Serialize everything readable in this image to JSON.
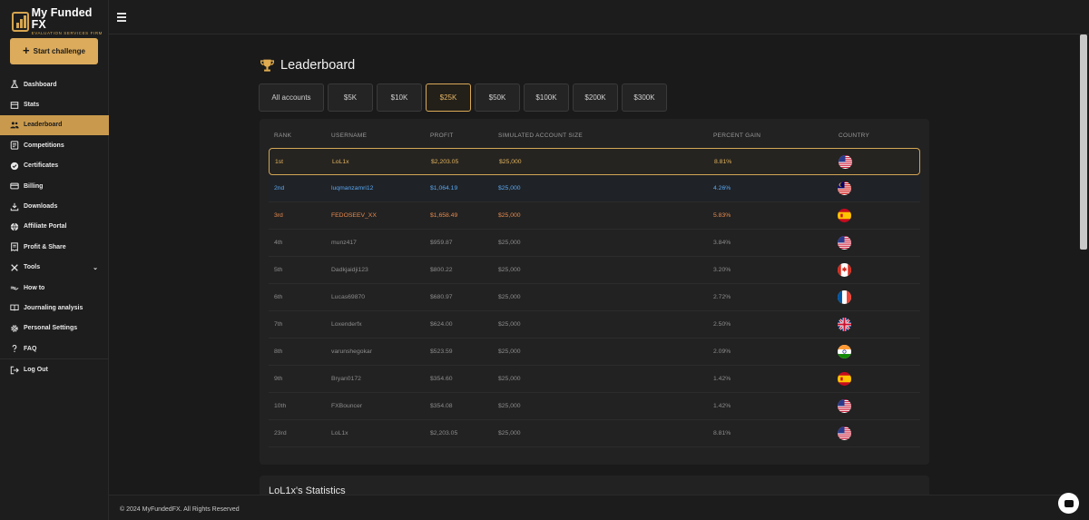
{
  "brand": {
    "name": "My Funded FX",
    "tagline": "EVALUATION SERVICES FIRM",
    "accent": "#dcab5b"
  },
  "sidebar": {
    "start_label": "Start challenge",
    "items": [
      {
        "label": "Dashboard",
        "icon": "flask-icon"
      },
      {
        "label": "Stats",
        "icon": "box-icon"
      },
      {
        "label": "Leaderboard",
        "icon": "users-icon",
        "active": true
      },
      {
        "label": "Competitions",
        "icon": "document-icon"
      },
      {
        "label": "Certificates",
        "icon": "badge-icon"
      },
      {
        "label": "Billing",
        "icon": "card-icon"
      },
      {
        "label": "Downloads",
        "icon": "download-icon"
      },
      {
        "label": "Affiliate Portal",
        "icon": "globe-icon"
      },
      {
        "label": "Profit & Share",
        "icon": "receipt-icon"
      },
      {
        "label": "Tools",
        "icon": "tools-icon"
      },
      {
        "label": "How to",
        "icon": "hand-icon"
      },
      {
        "label": "Journaling analysis",
        "icon": "book-icon"
      },
      {
        "label": "Personal Settings",
        "icon": "gear-icon"
      },
      {
        "label": "FAQ",
        "icon": "question-icon"
      },
      {
        "label": "Log Out",
        "icon": "logout-icon"
      }
    ]
  },
  "leaderboard": {
    "title": "Leaderboard",
    "filters": [
      "All accounts",
      "$5K",
      "$10K",
      "$25K",
      "$50K",
      "$100K",
      "$200K",
      "$300K"
    ],
    "active_filter": "$25K",
    "columns": [
      "RANK",
      "USERNAME",
      "PROFIT",
      "SIMULATED ACCOUNT SIZE",
      "PERCENT GAIN",
      "COUNTRY"
    ],
    "rows": [
      {
        "rank": "1st",
        "username": "LoL1x",
        "profit": "$2,203.05",
        "size": "$25,000",
        "gain": "8.81%",
        "country": "us"
      },
      {
        "rank": "2nd",
        "username": "luqmanzamri12",
        "profit": "$1,064.19",
        "size": "$25,000",
        "gain": "4.26%",
        "country": "my"
      },
      {
        "rank": "3rd",
        "username": "FEDOSEEV_XX",
        "profit": "$1,658.49",
        "size": "$25,000",
        "gain": "5.83%",
        "country": "es"
      },
      {
        "rank": "4th",
        "username": "munz417",
        "profit": "$959.87",
        "size": "$25,000",
        "gain": "3.84%",
        "country": "us"
      },
      {
        "rank": "5th",
        "username": "Dadkjaidji123",
        "profit": "$800.22",
        "size": "$25,000",
        "gain": "3.20%",
        "country": "ca"
      },
      {
        "rank": "6th",
        "username": "Lucas69870",
        "profit": "$680.97",
        "size": "$25,000",
        "gain": "2.72%",
        "country": "fr"
      },
      {
        "rank": "7th",
        "username": "Loxenderfx",
        "profit": "$624.00",
        "size": "$25,000",
        "gain": "2.50%",
        "country": "gb"
      },
      {
        "rank": "8th",
        "username": "varunshegokar",
        "profit": "$523.59",
        "size": "$25,000",
        "gain": "2.09%",
        "country": "in"
      },
      {
        "rank": "9th",
        "username": "Bryan0172",
        "profit": "$354.60",
        "size": "$25,000",
        "gain": "1.42%",
        "country": "es"
      },
      {
        "rank": "10th",
        "username": "FXBouncer",
        "profit": "$354.08",
        "size": "$25,000",
        "gain": "1.42%",
        "country": "us"
      },
      {
        "rank": "23rd",
        "username": "LoL1x",
        "profit": "$2,203.05",
        "size": "$25,000",
        "gain": "8.81%",
        "country": "us"
      }
    ]
  },
  "stats": {
    "title": "LoL1x's Statistics"
  },
  "footer": {
    "text": "© 2024 MyFundedFX. All Rights Reserved"
  }
}
